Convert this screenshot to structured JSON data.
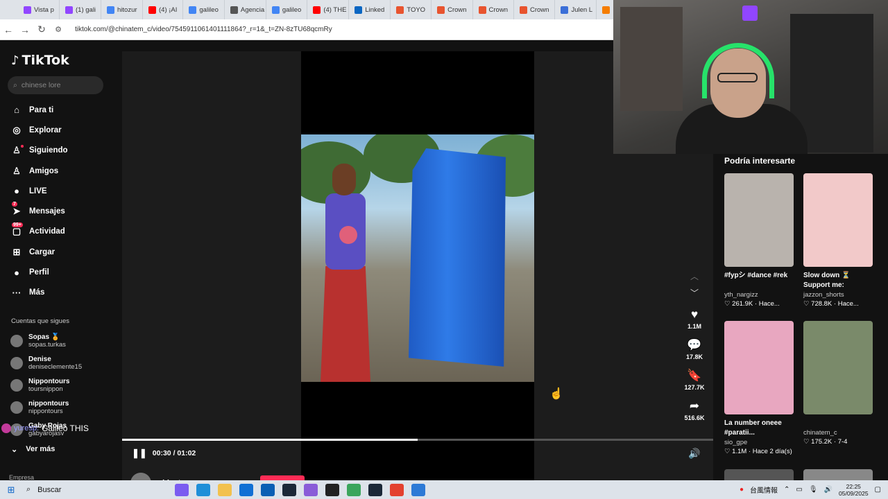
{
  "browser": {
    "tabs": [
      {
        "label": "Vista p",
        "color": "#9146ff"
      },
      {
        "label": "(1) gali",
        "color": "#9146ff"
      },
      {
        "label": "hitozur",
        "color": "#4285f4"
      },
      {
        "label": "(4) ¡AI",
        "color": "#ff0000"
      },
      {
        "label": "galileo",
        "color": "#4285f4"
      },
      {
        "label": "Agencia",
        "color": "#555555"
      },
      {
        "label": "galileo",
        "color": "#4285f4"
      },
      {
        "label": "(4) THE",
        "color": "#ff0000"
      },
      {
        "label": "Linked",
        "color": "#0a66c2"
      },
      {
        "label": "TOYO",
        "color": "#e8542f"
      },
      {
        "label": "Crown",
        "color": "#e8542f"
      },
      {
        "label": "Crown",
        "color": "#e8542f"
      },
      {
        "label": "Crown",
        "color": "#e8542f"
      },
      {
        "label": "Julen L",
        "color": "#3b6fd8"
      },
      {
        "label": "Blogg",
        "color": "#f57d00"
      }
    ],
    "url": "tiktok.com/@chinatem_c/video/7545911061401111864?_r=1&_t=ZN-8zTU68qcmRy"
  },
  "sidebar": {
    "logo": "TikTok",
    "search_placeholder": "chinese lore",
    "menu": [
      {
        "label": "Para ti",
        "icon": "home-icon",
        "glyph": "⌂"
      },
      {
        "label": "Explorar",
        "icon": "compass-icon",
        "glyph": "◎"
      },
      {
        "label": "Siguiendo",
        "icon": "following-icon",
        "glyph": "♙"
      },
      {
        "label": "Amigos",
        "icon": "friends-icon",
        "glyph": "♙"
      },
      {
        "label": "LIVE",
        "icon": "live-icon",
        "glyph": "●"
      },
      {
        "label": "Mensajes",
        "icon": "messages-icon",
        "glyph": "➤",
        "badge": "7"
      },
      {
        "label": "Actividad",
        "icon": "activity-icon",
        "glyph": "▢",
        "badge": "99+"
      },
      {
        "label": "Cargar",
        "icon": "upload-icon",
        "glyph": "⊞"
      },
      {
        "label": "Perfil",
        "icon": "profile-icon",
        "glyph": "●"
      },
      {
        "label": "Más",
        "icon": "more-icon",
        "glyph": "···"
      }
    ],
    "following_title": "Cuentas que sigues",
    "following": [
      {
        "name": "Sopas 🏅",
        "handle": "sopas.turkas"
      },
      {
        "name": "Denise",
        "handle": "deniseclemente15"
      },
      {
        "name": "Nippontours",
        "handle": "toursnippon"
      },
      {
        "name": "nippontours",
        "handle": "nippontours"
      },
      {
        "name": "Gaby Rojas",
        "handle": "gabyarojasv"
      }
    ],
    "see_more": "Ver más",
    "company": "Empresa"
  },
  "chat_overlay": {
    "prefix": "yuresp:",
    "message": "Galileo THIS"
  },
  "video": {
    "time": "00:30 / 01:02",
    "progress": 0.5,
    "author": "chinatem_c",
    "likes": "1.1M",
    "comments": "17.8K",
    "saves": "127.7K",
    "shares": "516.6K"
  },
  "suggestions": {
    "title": "Podría interesarte",
    "items": [
      {
        "caption": "#fypシ #dance #rek",
        "user": "yth_nargizz",
        "meta": "♡ 261.9K · Hace...",
        "color": "#b9b3ad"
      },
      {
        "caption": "Slow down ⏳ Support me: Patreo...",
        "user": "jazzon_shorts",
        "meta": "♡ 728.8K · Hace...",
        "color": "#f2c9c9"
      },
      {
        "caption": "La number oneee #paratii...",
        "user": "sio_gpe",
        "meta": "♡ 1.1M · Hace 2 día(s)",
        "color": "#e8a7c0"
      },
      {
        "caption": "",
        "user": "chinatem_c",
        "meta": "♡ 175.2K · 7-4",
        "color": "#7a8a6a"
      }
    ]
  },
  "taskbar": {
    "search": "Buscar",
    "ime": "台風情報",
    "time": "22:25",
    "date": "05/09/2025"
  }
}
